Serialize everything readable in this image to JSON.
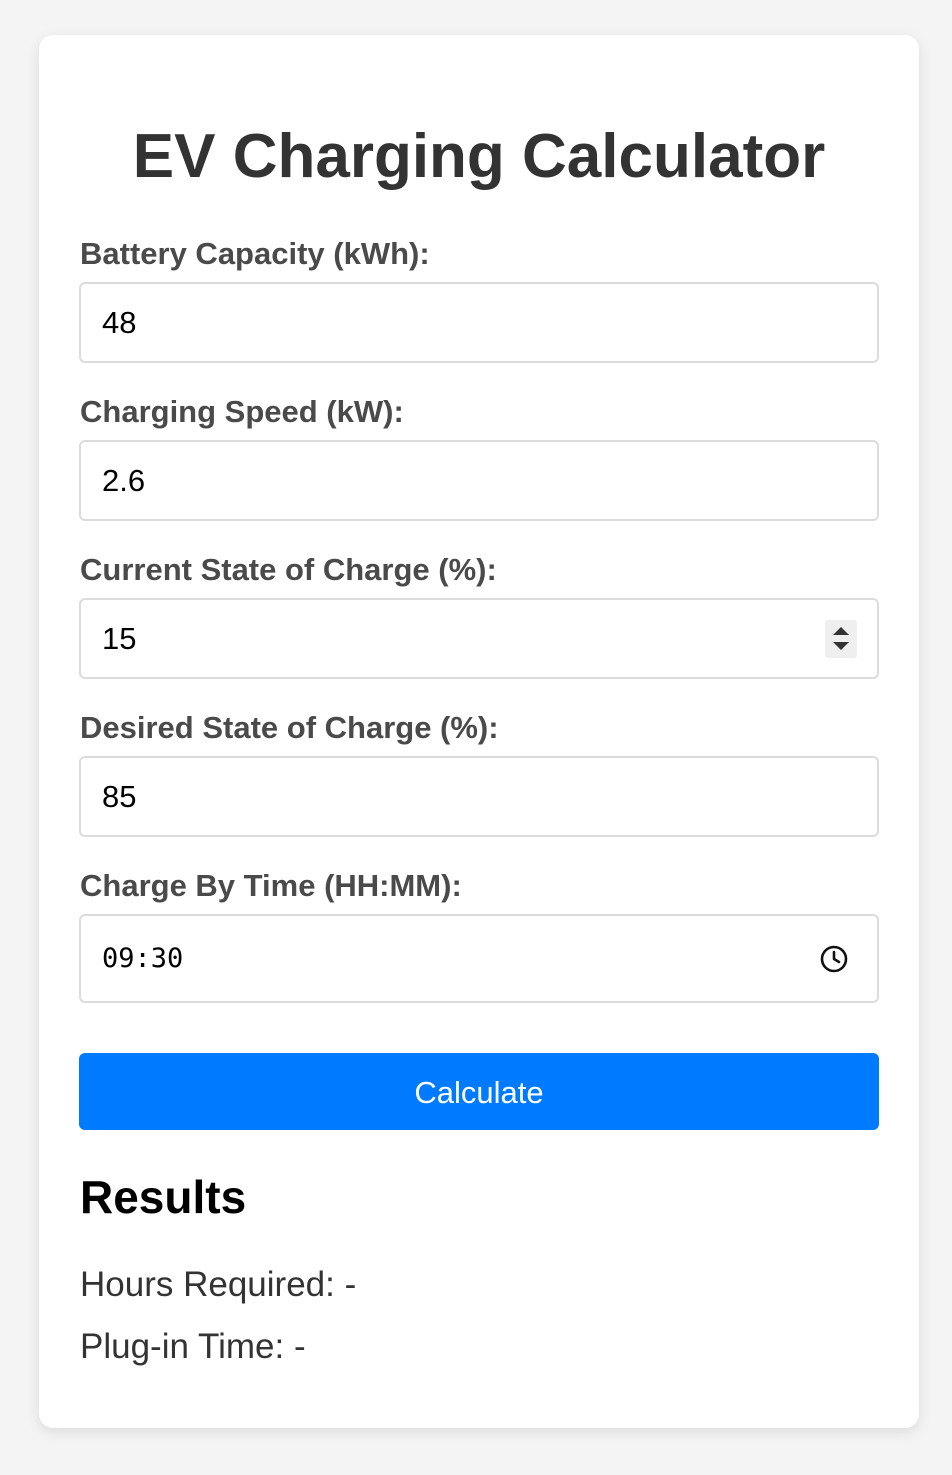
{
  "title": "EV Charging Calculator",
  "fields": [
    {
      "label": "Battery Capacity (kWh):",
      "value": "48"
    },
    {
      "label": "Charging Speed (kW):",
      "value": "2.6"
    },
    {
      "label": "Current State of Charge (%):",
      "value": "15"
    },
    {
      "label": "Desired State of Charge (%):",
      "value": "85"
    },
    {
      "label": "Charge By Time (HH:MM):",
      "value": "09:30"
    }
  ],
  "calculate_label": "Calculate",
  "results": {
    "heading": "Results",
    "hours_required": "Hours Required: -",
    "plug_in_time": "Plug-in Time: -"
  },
  "colors": {
    "accent": "#007bff",
    "background": "#f4f4f4",
    "card": "#ffffff",
    "label": "#4a4a4a",
    "title": "#333333"
  }
}
